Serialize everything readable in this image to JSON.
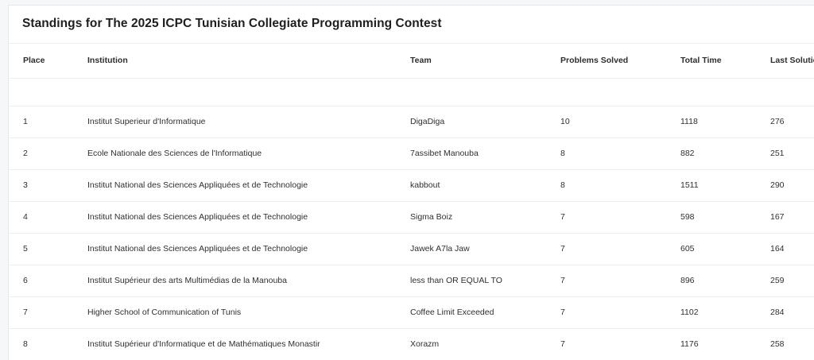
{
  "page": {
    "title": "Standings for The 2025 ICPC Tunisian Collegiate Programming Contest"
  },
  "table": {
    "columns": [
      "Place",
      "Institution",
      "Team",
      "Problems Solved",
      "Total Time",
      "Last Solution"
    ],
    "rows": [
      {
        "place": "1",
        "institution": "Institut Superieur d'Informatique",
        "team": "DigaDiga",
        "problems_solved": "10",
        "total_time": "1118",
        "last_solution": "276"
      },
      {
        "place": "2",
        "institution": "Ecole Nationale des Sciences de l'Informatique",
        "team": "7assibet Manouba",
        "problems_solved": "8",
        "total_time": "882",
        "last_solution": "251"
      },
      {
        "place": "3",
        "institution": "Institut National des Sciences Appliquées et de Technologie",
        "team": "kabbout",
        "problems_solved": "8",
        "total_time": "1511",
        "last_solution": "290"
      },
      {
        "place": "4",
        "institution": "Institut National des Sciences Appliquées et de Technologie",
        "team": "Sigma Boiz",
        "problems_solved": "7",
        "total_time": "598",
        "last_solution": "167"
      },
      {
        "place": "5",
        "institution": "Institut National des Sciences Appliquées et de Technologie",
        "team": "Jawek A7la Jaw",
        "problems_solved": "7",
        "total_time": "605",
        "last_solution": "164"
      },
      {
        "place": "6",
        "institution": "Institut Supérieur des arts Multimédias de la Manouba",
        "team": "less than OR EQUAL TO",
        "problems_solved": "7",
        "total_time": "896",
        "last_solution": "259"
      },
      {
        "place": "7",
        "institution": "Higher School of Communication of Tunis",
        "team": "Coffee Limit Exceeded",
        "problems_solved": "7",
        "total_time": "1102",
        "last_solution": "284"
      },
      {
        "place": "8",
        "institution": "Institut Supérieur d'Informatique et de Mathématiques Monastir",
        "team": "Xorazm",
        "problems_solved": "7",
        "total_time": "1176",
        "last_solution": "258"
      }
    ]
  }
}
